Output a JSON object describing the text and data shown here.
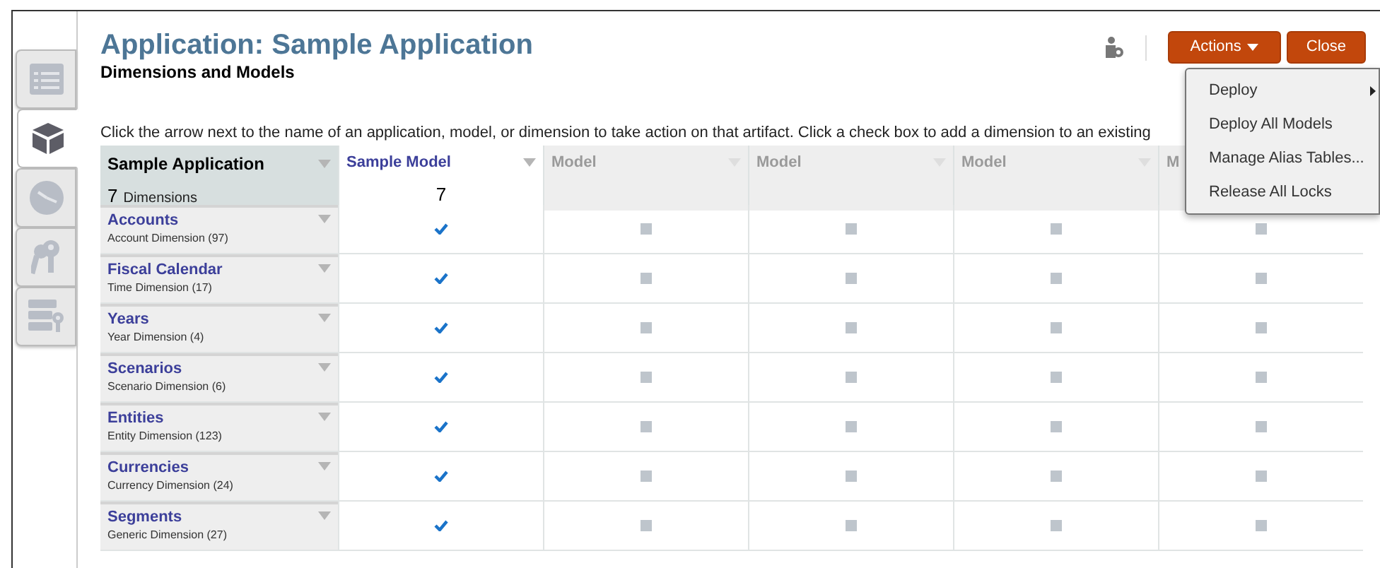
{
  "side_tabs": [
    {
      "selected": false
    },
    {
      "selected": true
    },
    {
      "selected": false
    },
    {
      "selected": false
    },
    {
      "selected": false
    }
  ],
  "title": "Application: Sample Application",
  "subtitle": "Dimensions and Models",
  "instructions": "Click the arrow next to the name of an application, model, or dimension to take action on that artifact. Click a check box to add a dimension to an existing",
  "buttons": {
    "actions": "Actions",
    "close": "Close"
  },
  "actions_menu": [
    {
      "label": "Deploy",
      "has_submenu": true
    },
    {
      "label": "Deploy All Models",
      "has_submenu": false
    },
    {
      "label": "Manage Alias Tables...",
      "has_submenu": false
    },
    {
      "label": "Release All Locks",
      "has_submenu": false
    }
  ],
  "table": {
    "application": {
      "name": "Sample Application",
      "count": "7",
      "count_label": "Dimensions"
    },
    "models": [
      {
        "name": "Sample Model",
        "count": "7",
        "active": true
      },
      {
        "name": "Model",
        "active": false
      },
      {
        "name": "Model",
        "active": false
      },
      {
        "name": "Model",
        "active": false
      },
      {
        "name": "M",
        "active": false
      }
    ],
    "rows": [
      {
        "name": "Accounts",
        "type": "Account Dimension",
        "count": "(97)",
        "checks": [
          true,
          false,
          false,
          false,
          false
        ]
      },
      {
        "name": "Fiscal Calendar",
        "type": "Time Dimension",
        "count": "(17)",
        "checks": [
          true,
          false,
          false,
          false,
          false
        ]
      },
      {
        "name": "Years",
        "type": "Year Dimension",
        "count": "(4)",
        "checks": [
          true,
          false,
          false,
          false,
          false
        ]
      },
      {
        "name": "Scenarios",
        "type": "Scenario Dimension",
        "count": "(6)",
        "checks": [
          true,
          false,
          false,
          false,
          false
        ]
      },
      {
        "name": "Entities",
        "type": "Entity Dimension",
        "count": "(123)",
        "checks": [
          true,
          false,
          false,
          false,
          false
        ]
      },
      {
        "name": "Currencies",
        "type": "Currency Dimension",
        "count": "(24)",
        "checks": [
          true,
          false,
          false,
          false,
          false
        ]
      },
      {
        "name": "Segments",
        "type": "Generic Dimension",
        "count": "(27)",
        "checks": [
          true,
          false,
          false,
          false,
          false
        ]
      }
    ]
  }
}
